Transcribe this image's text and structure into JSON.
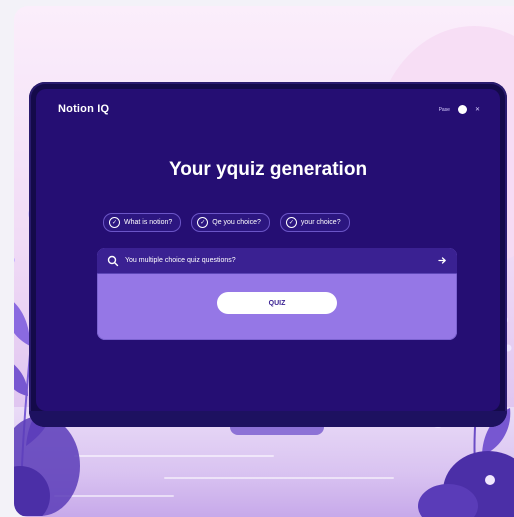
{
  "app": {
    "brand": "Notion IQ",
    "top_label": "Pase",
    "top_close": "✕"
  },
  "hero": {
    "title": "Your yquiz generation"
  },
  "chips": [
    {
      "label": "What is notion?"
    },
    {
      "label": "Qe you choice?"
    },
    {
      "label": "your choice?"
    }
  ],
  "search": {
    "value": "You multiple choice quiz questions?"
  },
  "quiz_button": {
    "label": "QUIZ"
  },
  "colors": {
    "screen": "#250e73",
    "bezel": "#140a4a",
    "panel": "#9577e6",
    "accent": "#ffffff"
  }
}
